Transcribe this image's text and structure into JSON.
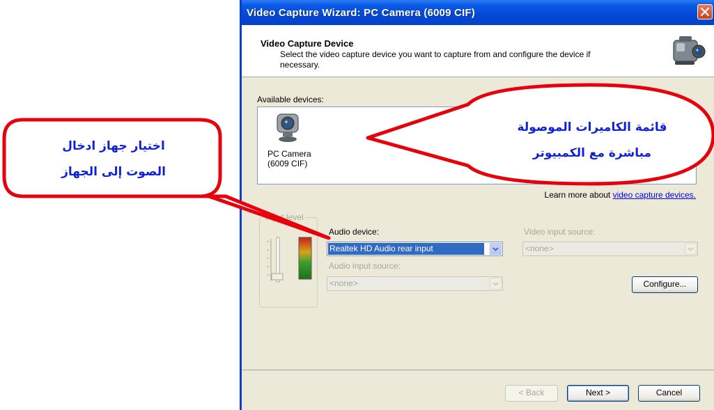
{
  "window": {
    "title": "Video Capture Wizard: PC Camera (6009 CIF)",
    "header_title": "Video Capture Device",
    "header_desc": "Select the video capture device you want to capture from and configure the device if necessary."
  },
  "devices": {
    "label": "Available devices:",
    "items": [
      {
        "name": "PC Camera\n(6009 CIF)",
        "icon": "webcam-icon"
      }
    ]
  },
  "learn_more": {
    "prefix": "Learn more about ",
    "link": "video capture devices."
  },
  "input_level": {
    "legend": "Input level"
  },
  "audio_device": {
    "label": "Audio device:",
    "value": "Realtek HD Audio rear input"
  },
  "audio_input_source": {
    "label": "Audio input source:",
    "value": "<none>"
  },
  "video_input_source": {
    "label": "Video input source:",
    "value": "<none>"
  },
  "configure_label": "Configure...",
  "buttons": {
    "back": "< Back",
    "next": "Next >",
    "cancel": "Cancel"
  },
  "callouts": {
    "left_line1": "اختيار جهاز ادخال",
    "left_line2": "الصوت إلى الجهاز",
    "right_line1": "قائمة الكاميرات الموصولة",
    "right_line2": "مباشرة مع الكمبيوتر"
  },
  "colors": {
    "callout_border": "#E8000B",
    "callout_text": "#1020E0",
    "titlebar": "#0349D6",
    "selection": "#316AC5"
  }
}
